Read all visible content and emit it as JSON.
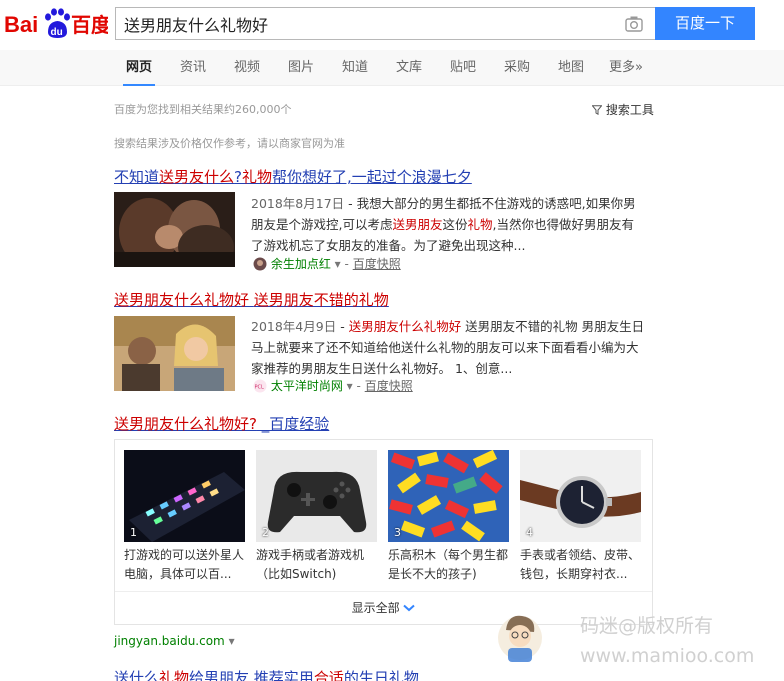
{
  "header": {
    "logo_text_left": "Bai",
    "logo_text_du": "du",
    "logo_text_right": "百度",
    "search_value": "送男朋友什么礼物好",
    "search_button": "百度一下",
    "camera_icon": "camera-icon"
  },
  "tabs": [
    {
      "label": "网页",
      "active": true
    },
    {
      "label": "资讯"
    },
    {
      "label": "视频"
    },
    {
      "label": "图片"
    },
    {
      "label": "知道"
    },
    {
      "label": "文库"
    },
    {
      "label": "贴吧"
    },
    {
      "label": "采购"
    },
    {
      "label": "地图"
    },
    {
      "label": "更多»"
    }
  ],
  "meta": {
    "result_count": "百度为您找到相关结果约260,000个",
    "search_tools": "搜索工具",
    "notice": "搜索结果涉及价格仅作参考，请以商家官网为准"
  },
  "results": [
    {
      "title_parts": [
        "不知道",
        "送男友什么",
        "?",
        "礼物",
        "帮你想好了,一起过个浪漫七夕"
      ],
      "date": "2018年8月17日",
      "snippet_a": " - 我想大部分的男生都抵不住游戏的诱惑吧,如果你男朋友是个游戏控,可以考虑",
      "snippet_hl1": "送男朋友",
      "snippet_b": "这份",
      "snippet_hl2": "礼物",
      "snippet_c": ",当然你也得做好男朋友有了游戏机忘了女朋友的准备。为了避免出现这种...",
      "source": "余生加点红",
      "snapshot": "百度快照"
    },
    {
      "title_part1": "送男朋友什么礼物好",
      "title_part2": "送男朋友不错的礼物",
      "date": "2018年4月9日",
      "snippet_dash": " - ",
      "snippet_hl": "送男朋友什么礼物好",
      "snippet_b": " 送男朋友不错的礼物 男朋友生日马上就要来了还不知道给他送什么礼物的朋友可以来下面看看小编为大家推荐的男朋友生日送什么礼物好。 1、创意...",
      "source": "太平洋时尚网",
      "snapshot": "百度快照"
    },
    {
      "title_hl": "送男朋友什么礼物好?",
      "title_rest": " _百度经验"
    }
  ],
  "jingyan": {
    "items": [
      {
        "num": "1",
        "text": "打游戏的可以送外星人电脑，具体可以百..."
      },
      {
        "num": "2",
        "text": "游戏手柄或者游戏机（比如Switch)"
      },
      {
        "num": "3",
        "text": "乐高积木（每个男生都是长不大的孩子)"
      },
      {
        "num": "4",
        "text": "手表或者领结、皮带、钱包，长期穿衬衣..."
      }
    ],
    "show_all": "显示全部",
    "domain": "jingyan.baidu.com"
  },
  "next_result": {
    "title_a": "送什么",
    "title_hl": "礼物",
    "title_b": "给男朋友 推荐实用",
    "title_hl2": "合适",
    "title_c": "的生日礼物"
  },
  "watermark": {
    "line1": "码迷@版权所有",
    "line2": "www.mamioo.com"
  },
  "colors": {
    "accent": "#3385ff",
    "link": "#2440b3",
    "highlight": "#cc0000",
    "source_green": "#008000"
  }
}
